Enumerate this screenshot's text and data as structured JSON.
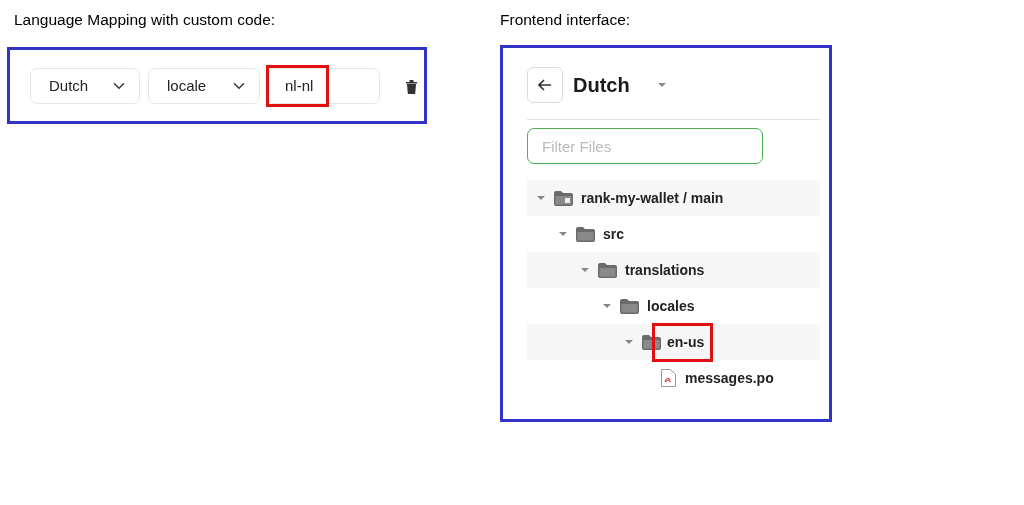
{
  "left": {
    "caption": "Language Mapping with custom code:",
    "mapping": {
      "language": {
        "value": "Dutch"
      },
      "type": {
        "value": "locale"
      },
      "code": {
        "value": "nl-nl",
        "highlighted": true
      }
    }
  },
  "right": {
    "caption": "Frontend interface:",
    "header": {
      "title": "Dutch"
    },
    "filter": {
      "placeholder": "Filter Files"
    },
    "tree": [
      {
        "label": "rank-my-wallet / main",
        "kind": "repo",
        "expanded": true,
        "highlighted": false,
        "children": [
          {
            "label": "src",
            "kind": "folder",
            "expanded": true,
            "highlighted": false,
            "children": [
              {
                "label": "translations",
                "kind": "folder",
                "expanded": true,
                "highlighted": false,
                "children": [
                  {
                    "label": "locales",
                    "kind": "folder",
                    "expanded": true,
                    "highlighted": false,
                    "children": [
                      {
                        "label": "en-us",
                        "kind": "folder",
                        "expanded": true,
                        "highlighted": true,
                        "children": [
                          {
                            "label": "messages.po",
                            "kind": "file",
                            "highlighted": false
                          }
                        ]
                      }
                    ]
                  }
                ]
              }
            ]
          }
        ]
      }
    ]
  }
}
